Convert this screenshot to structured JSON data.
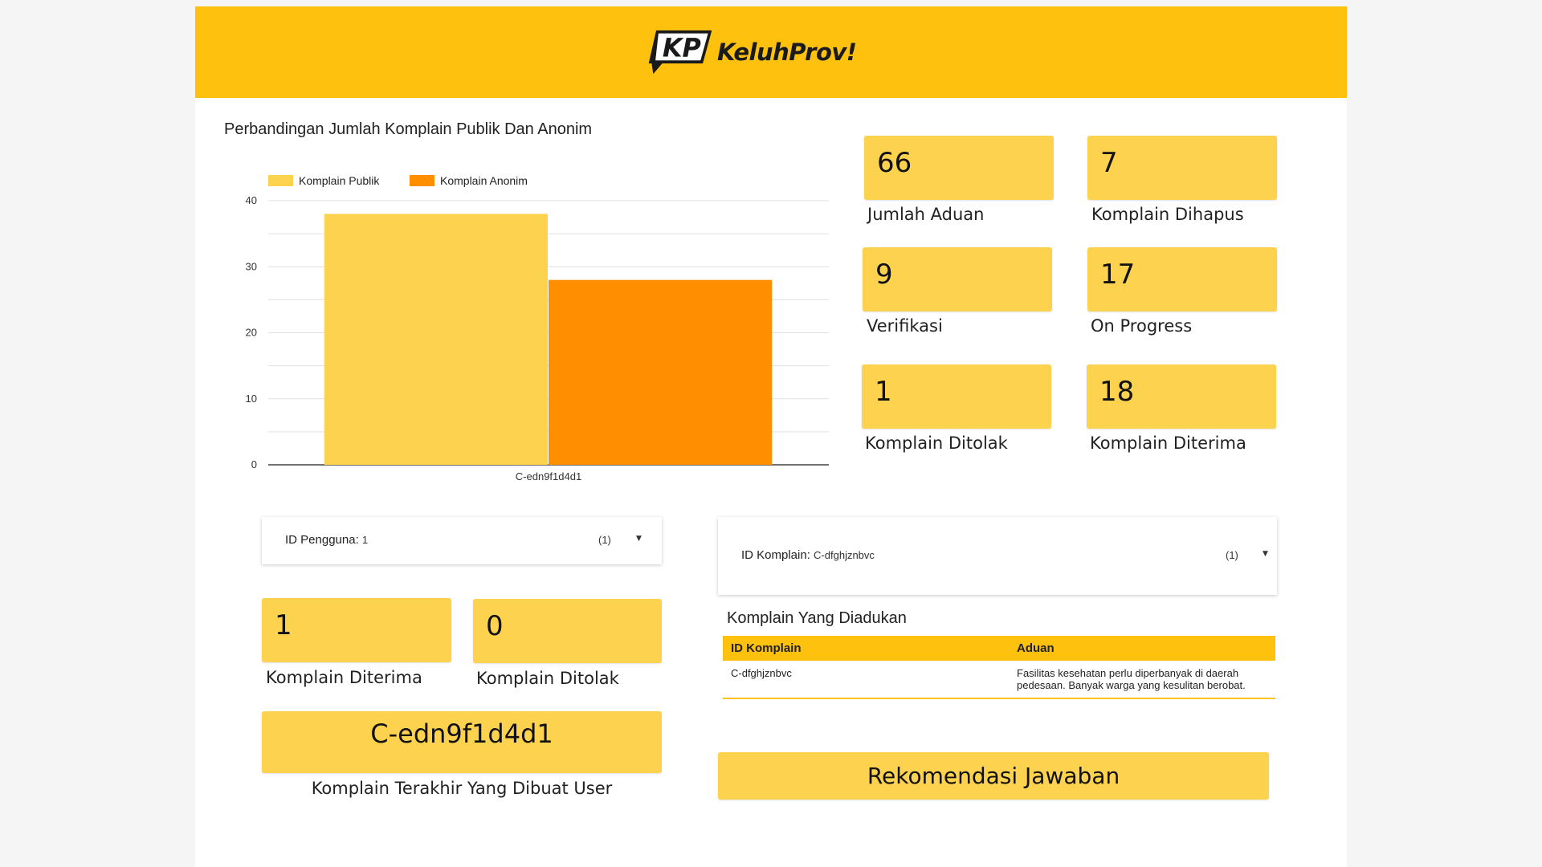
{
  "header": {
    "logo_badge": "KP",
    "logo_text": "KeluhProv!",
    "colors": {
      "brand_yellow": "#fdc10e",
      "card_yellow": "#fdd24f",
      "anonim_orange": "#ff8f00"
    }
  },
  "chart_title": "Perbandingan Jumlah Komplain Publik Dan Anonim",
  "chart_data": {
    "type": "bar",
    "categories": [
      "C-edn9f1d4d1"
    ],
    "series": [
      {
        "name": "Komplain Publik",
        "values": [
          38
        ],
        "color": "#fdd24f"
      },
      {
        "name": "Komplain Anonim",
        "values": [
          28
        ],
        "color": "#ff8f00"
      }
    ],
    "ylim": [
      0,
      40
    ],
    "yticks": [
      0,
      10,
      20,
      30,
      40
    ],
    "grid": true,
    "legend_position": "top-left"
  },
  "stats": [
    {
      "value": "66",
      "label": "Jumlah Aduan"
    },
    {
      "value": "7",
      "label": "Komplain Dihapus"
    },
    {
      "value": "9",
      "label": "Verifikasi"
    },
    {
      "value": "17",
      "label": "On Progress"
    },
    {
      "value": "1",
      "label": "Komplain Ditolak"
    },
    {
      "value": "18",
      "label": "Komplain Diterima"
    }
  ],
  "user_filter": {
    "label": "ID Pengguna",
    "value": "1",
    "count": "(1)"
  },
  "user_stats": [
    {
      "value": "1",
      "label": "Komplain Diterima"
    },
    {
      "value": "0",
      "label": "Komplain Ditolak"
    }
  ],
  "last_complaint": {
    "value": "C-edn9f1d4d1",
    "label": "Komplain Terakhir Yang Dibuat User"
  },
  "complaint_filter": {
    "label": "ID Komplain",
    "value": "C-dfghjznbvc",
    "count": "(1)"
  },
  "complaints_table": {
    "title": "Komplain Yang Diadukan",
    "headers": [
      "ID Komplain",
      "Aduan"
    ],
    "rows": [
      {
        "id": "C-dfghjznbvc",
        "aduan": "Fasilitas kesehatan perlu diperbanyak di daerah pedesaan. Banyak warga yang kesulitan berobat."
      }
    ]
  },
  "recommend_button": "Rekomendasi Jawaban"
}
